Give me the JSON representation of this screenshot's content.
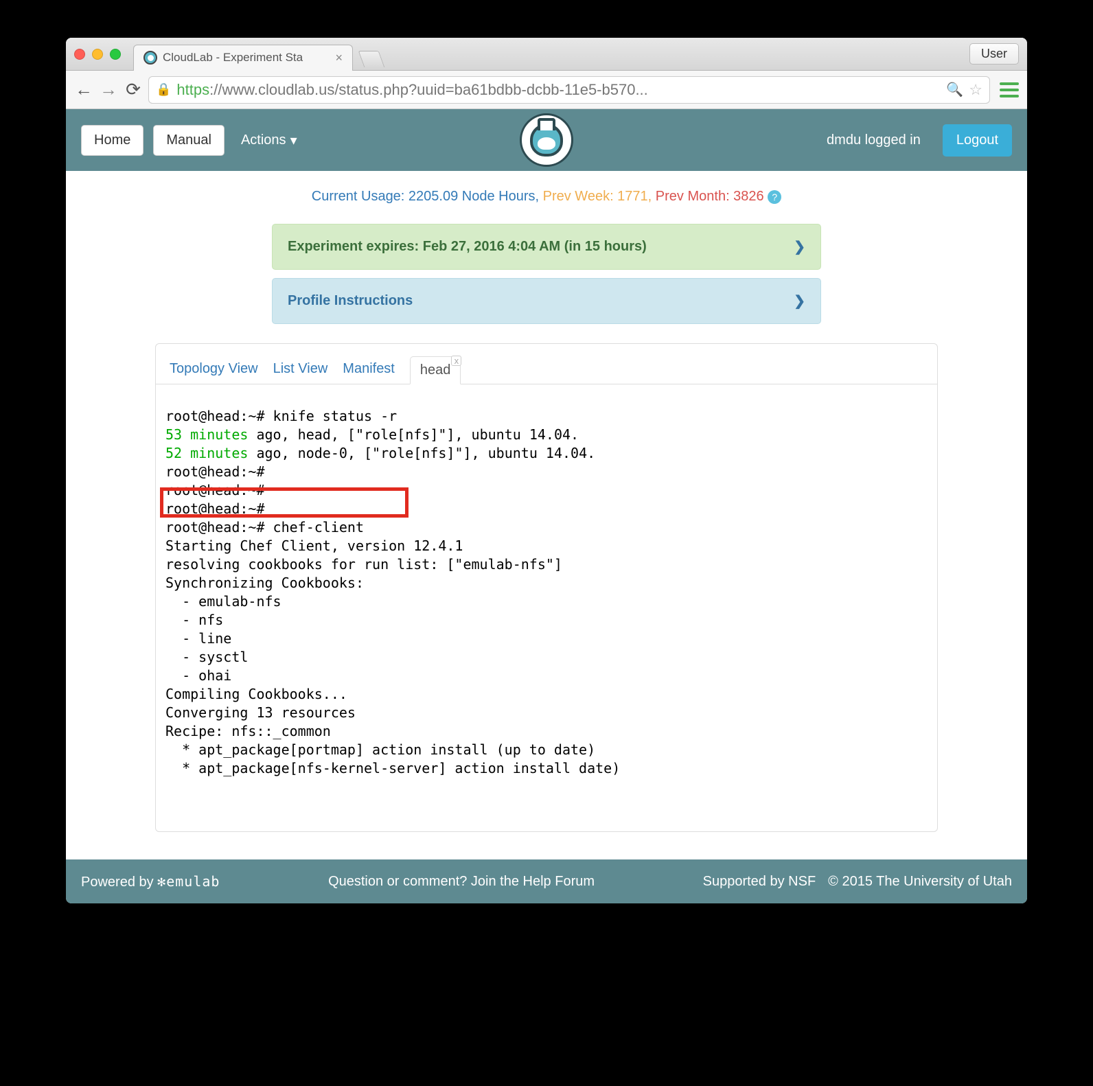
{
  "browser": {
    "tab_title": "CloudLab - Experiment Sta",
    "user_button": "User",
    "url_protocol": "https",
    "url_display": "://www.cloudlab.us/status.php?uuid=ba61bdbb-dcbb-11e5-b570..."
  },
  "header": {
    "home": "Home",
    "manual": "Manual",
    "actions": "Actions",
    "logged_in": "dmdu logged in",
    "logout": "Logout"
  },
  "usage": {
    "current_label": "Current Usage: 2205.09 Node Hours,",
    "prev_week": "Prev Week: 1771,",
    "prev_month": "Prev Month: 3826"
  },
  "panels": {
    "expire": "Experiment expires: Feb 27, 2016 4:04 AM (in 15 hours)",
    "instructions": "Profile Instructions"
  },
  "term_tabs": {
    "topology": "Topology View",
    "list": "List View",
    "manifest": "Manifest",
    "head": "head"
  },
  "terminal": {
    "l1": "root@head:~# knife status -r",
    "l2a": "53 minutes",
    "l2b": " ago, head, [\"role[nfs]\"], ubuntu 14.04.",
    "l3a": "52 minutes",
    "l3b": " ago, node-0, [\"role[nfs]\"], ubuntu 14.04.",
    "l4": "root@head:~#",
    "l5": "root@head:~#",
    "l6": "root@head:~#",
    "l7": "root@head:~# chef-client",
    "l8": "Starting Chef Client, version 12.4.1",
    "l9": "resolving cookbooks for run list: [\"emulab-nfs\"]",
    "l10": "Synchronizing Cookbooks:",
    "l11": "  - emulab-nfs",
    "l12": "  - nfs",
    "l13": "  - line",
    "l14": "  - sysctl",
    "l15": "  - ohai",
    "l16": "Compiling Cookbooks...",
    "l17": "Converging 13 resources",
    "l18": "Recipe: nfs::_common",
    "l19": "  * apt_package[portmap] action install (up to date)",
    "l20": "  * apt_package[nfs-kernel-server] action install date)"
  },
  "footer": {
    "powered": "Powered by ",
    "emulab": "✻emulab",
    "question": "Question or comment? Join the Help Forum",
    "supported": "Supported by NSF",
    "copyright": "© 2015 The University of Utah"
  }
}
